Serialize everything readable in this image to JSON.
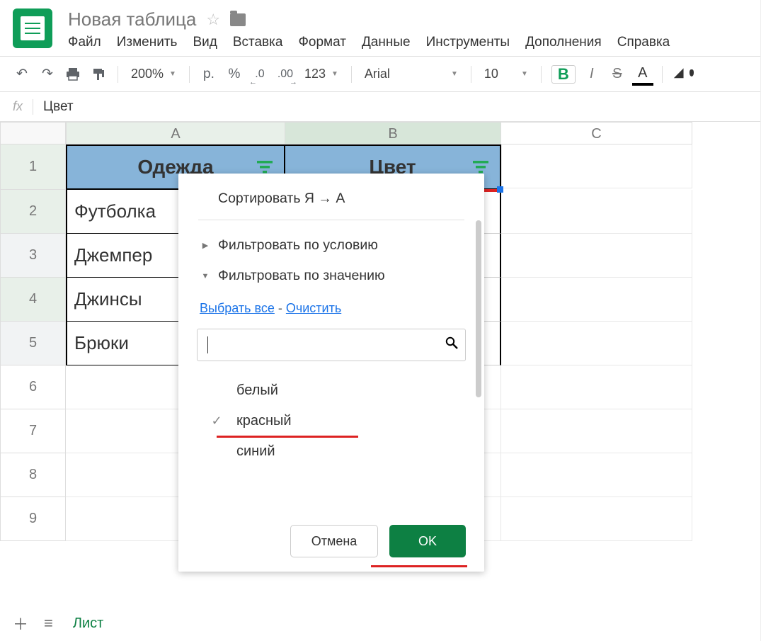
{
  "doc_title": "Новая таблица",
  "menubar": [
    "Файл",
    "Изменить",
    "Вид",
    "Вставка",
    "Формат",
    "Данные",
    "Инструменты",
    "Дополнения",
    "Справка"
  ],
  "toolbar": {
    "zoom": "200%",
    "currency": "р.",
    "percent": "%",
    "dec_minus": ".0",
    "dec_plus": ".00",
    "numfmt": "123",
    "font": "Arial",
    "size": "10",
    "bold": "B",
    "italic": "I",
    "strike": "S",
    "textcolor": "A"
  },
  "formula_bar": {
    "fx": "fx",
    "value": "Цвет"
  },
  "columns": {
    "A": "A",
    "B": "B",
    "C": "C"
  },
  "rows": {
    "header": {
      "A": "Одежда",
      "B": "Цвет"
    },
    "data": [
      {
        "n": "2",
        "A": "Футболка"
      },
      {
        "n": "3",
        "A": "Джемпер"
      },
      {
        "n": "4",
        "A": "Джинсы"
      },
      {
        "n": "5",
        "A": "Брюки"
      }
    ],
    "empty": [
      "6",
      "7",
      "8",
      "9"
    ]
  },
  "popup": {
    "sort_desc": "Сортировать Я → А",
    "filter_condition": "Фильтровать по условию",
    "filter_value": "Фильтровать по значению",
    "select_all": "Выбрать все",
    "clear": "Очистить",
    "link_sep": " - ",
    "values": [
      {
        "label": "белый",
        "checked": false
      },
      {
        "label": "красный",
        "checked": true,
        "highlight": true
      },
      {
        "label": "синий",
        "checked": false
      }
    ],
    "cancel": "Отмена",
    "ok": "OK"
  },
  "tabs": {
    "sheet1": "Лист"
  }
}
